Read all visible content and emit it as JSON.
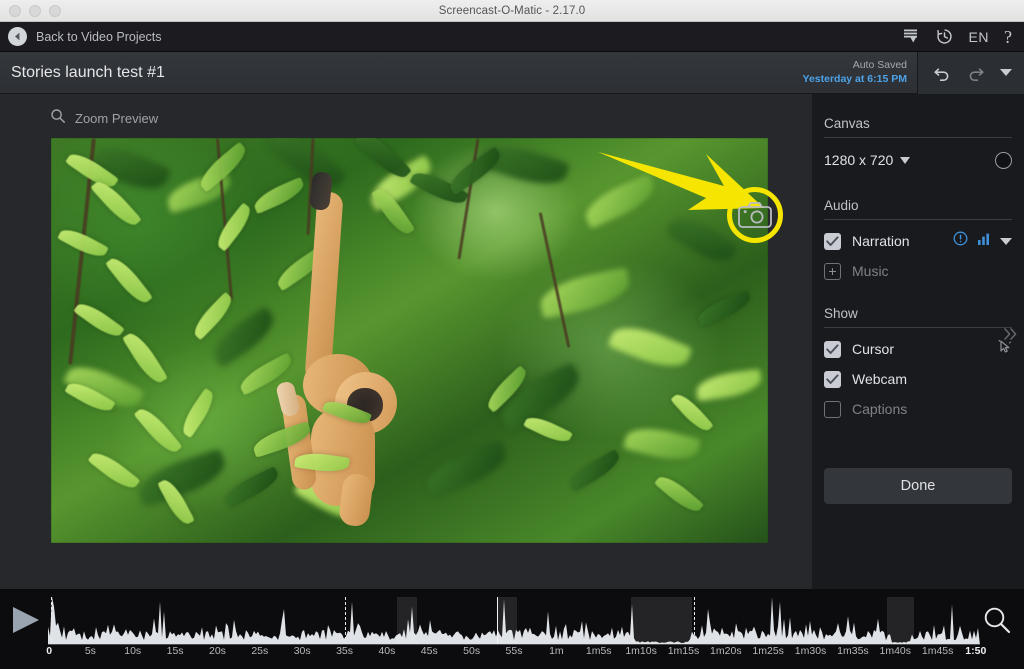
{
  "window": {
    "title": "Screencast-O-Matic - 2.17.0",
    "traffic_lights": [
      "close",
      "minimize",
      "zoom"
    ]
  },
  "topbar": {
    "back_label": "Back to Video Projects",
    "back_icon": "back-arrow-circle-icon",
    "icons": [
      {
        "name": "import-download-icon",
        "label": ""
      },
      {
        "name": "history-clock-icon",
        "label": ""
      }
    ],
    "language": "EN",
    "help": "?"
  },
  "projectbar": {
    "title": "Stories launch test #1",
    "autosave_label": "Auto Saved",
    "autosave_time": "Yesterday at 6:15 PM",
    "autosave_color": "#4da3e8",
    "undo_icon": "undo-icon",
    "redo_icon": "redo-icon",
    "more_icon": "chevron-down-icon"
  },
  "stage": {
    "zoom_preview_label": "Zoom Preview",
    "search_icon": "magnifier-icon",
    "camera_icon": "camera-icon",
    "highlight_color": "#f6e500",
    "annotation": "yellow-arrow-pointing-to-camera-button",
    "video_description": "gibbon hanging from tree branch in green foliage"
  },
  "panel": {
    "canvas": {
      "title": "Canvas",
      "resolution": "1280 x 720",
      "caret_icon": "chevron-down-icon",
      "color_dot": "canvas-color-dot"
    },
    "audio": {
      "title": "Audio",
      "items": [
        {
          "label": "Narration",
          "checked": true,
          "type": "checkbox",
          "tail_icons": [
            "warning-circle-icon",
            "levels-bars-icon",
            "chevron-down-icon"
          ]
        },
        {
          "label": "Music",
          "checked": false,
          "type": "plus",
          "tail_icons": []
        }
      ]
    },
    "show": {
      "title": "Show",
      "items": [
        {
          "label": "Cursor",
          "checked": true,
          "tail_icons": [
            "cursor-arrow-icon"
          ]
        },
        {
          "label": "Webcam",
          "checked": true,
          "tail_icons": []
        },
        {
          "label": "Captions",
          "checked": false,
          "tail_icons": []
        }
      ]
    },
    "done_label": "Done",
    "expander_icon": "double-chevron-right-icon"
  },
  "timeline": {
    "play_icon": "play-triangle-icon",
    "search_icon": "magnifier-zoom-icon",
    "duration_seconds": 110,
    "ticks": [
      {
        "label": "0",
        "t": 0,
        "bold": true
      },
      {
        "label": "5s",
        "t": 5
      },
      {
        "label": "10s",
        "t": 10
      },
      {
        "label": "15s",
        "t": 15
      },
      {
        "label": "20s",
        "t": 20
      },
      {
        "label": "25s",
        "t": 25
      },
      {
        "label": "30s",
        "t": 30
      },
      {
        "label": "35s",
        "t": 35
      },
      {
        "label": "40s",
        "t": 40
      },
      {
        "label": "45s",
        "t": 45
      },
      {
        "label": "50s",
        "t": 50
      },
      {
        "label": "55s",
        "t": 55
      },
      {
        "label": "1m",
        "t": 60
      },
      {
        "label": "1m5s",
        "t": 65
      },
      {
        "label": "1m10s",
        "t": 70
      },
      {
        "label": "1m15s",
        "t": 75
      },
      {
        "label": "1m20s",
        "t": 80
      },
      {
        "label": "1m25s",
        "t": 85
      },
      {
        "label": "1m30s",
        "t": 90
      },
      {
        "label": "1m35s",
        "t": 95
      },
      {
        "label": "1m40s",
        "t": 100
      },
      {
        "label": "1m45s",
        "t": 105
      },
      {
        "label": "1:50",
        "t": 110,
        "bold": true
      }
    ],
    "zoom_segments": [
      {
        "start": 41.2,
        "end": 43.6
      },
      {
        "start": 53.0,
        "end": 55.4
      },
      {
        "start": 68.8,
        "end": 76.0
      },
      {
        "start": 99.0,
        "end": 102.2
      }
    ],
    "markers": [
      {
        "t": 0.3,
        "style": "dash"
      },
      {
        "t": 35.0,
        "style": "dash"
      },
      {
        "t": 53.0,
        "style": "solid"
      },
      {
        "t": 76.3,
        "style": "dash"
      }
    ]
  }
}
